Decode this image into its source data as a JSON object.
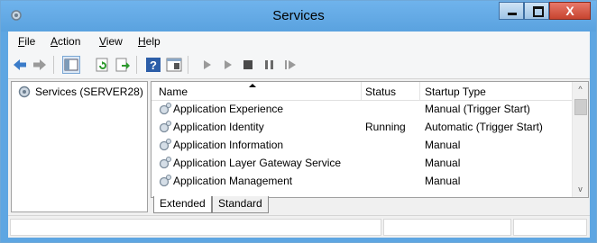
{
  "window": {
    "title": "Services",
    "close_glyph": "X",
    "title_bar_color": "#5ea6e2",
    "close_color": "#c7442f"
  },
  "menu": [
    {
      "label": "File",
      "mnemonic": "F",
      "rest": "ile"
    },
    {
      "label": "Action",
      "mnemonic": "A",
      "rest": "ction"
    },
    {
      "label": "View",
      "mnemonic": "V",
      "rest": "iew"
    },
    {
      "label": "Help",
      "mnemonic": "H",
      "rest": "elp"
    }
  ],
  "toolbar": {
    "icons": [
      "back-arrow-icon",
      "forward-arrow-icon",
      "show-hide-console-tree-icon",
      "refresh-icon",
      "export-list-icon",
      "help-icon",
      "properties-icon",
      "start-service-icon",
      "start-service-alt-icon",
      "stop-service-icon",
      "pause-service-icon",
      "resume-service-icon"
    ]
  },
  "tree": {
    "root_label": "Services (SERVER28)"
  },
  "table": {
    "columns": {
      "name": "Name",
      "status": "Status",
      "startup": "Startup Type"
    },
    "sort_column": "Name",
    "rows": [
      {
        "name": "Application Experience",
        "status": "",
        "startup": "Manual (Trigger Start)"
      },
      {
        "name": "Application Identity",
        "status": "Running",
        "startup": "Automatic (Trigger Start)"
      },
      {
        "name": "Application Information",
        "status": "",
        "startup": "Manual"
      },
      {
        "name": "Application Layer Gateway Service",
        "status": "",
        "startup": "Manual"
      },
      {
        "name": "Application Management",
        "status": "",
        "startup": "Manual"
      }
    ]
  },
  "tabs": [
    {
      "label": "Extended"
    },
    {
      "label": "Standard"
    }
  ],
  "scrollbar": {
    "up_glyph": "^",
    "down_glyph": "v"
  }
}
